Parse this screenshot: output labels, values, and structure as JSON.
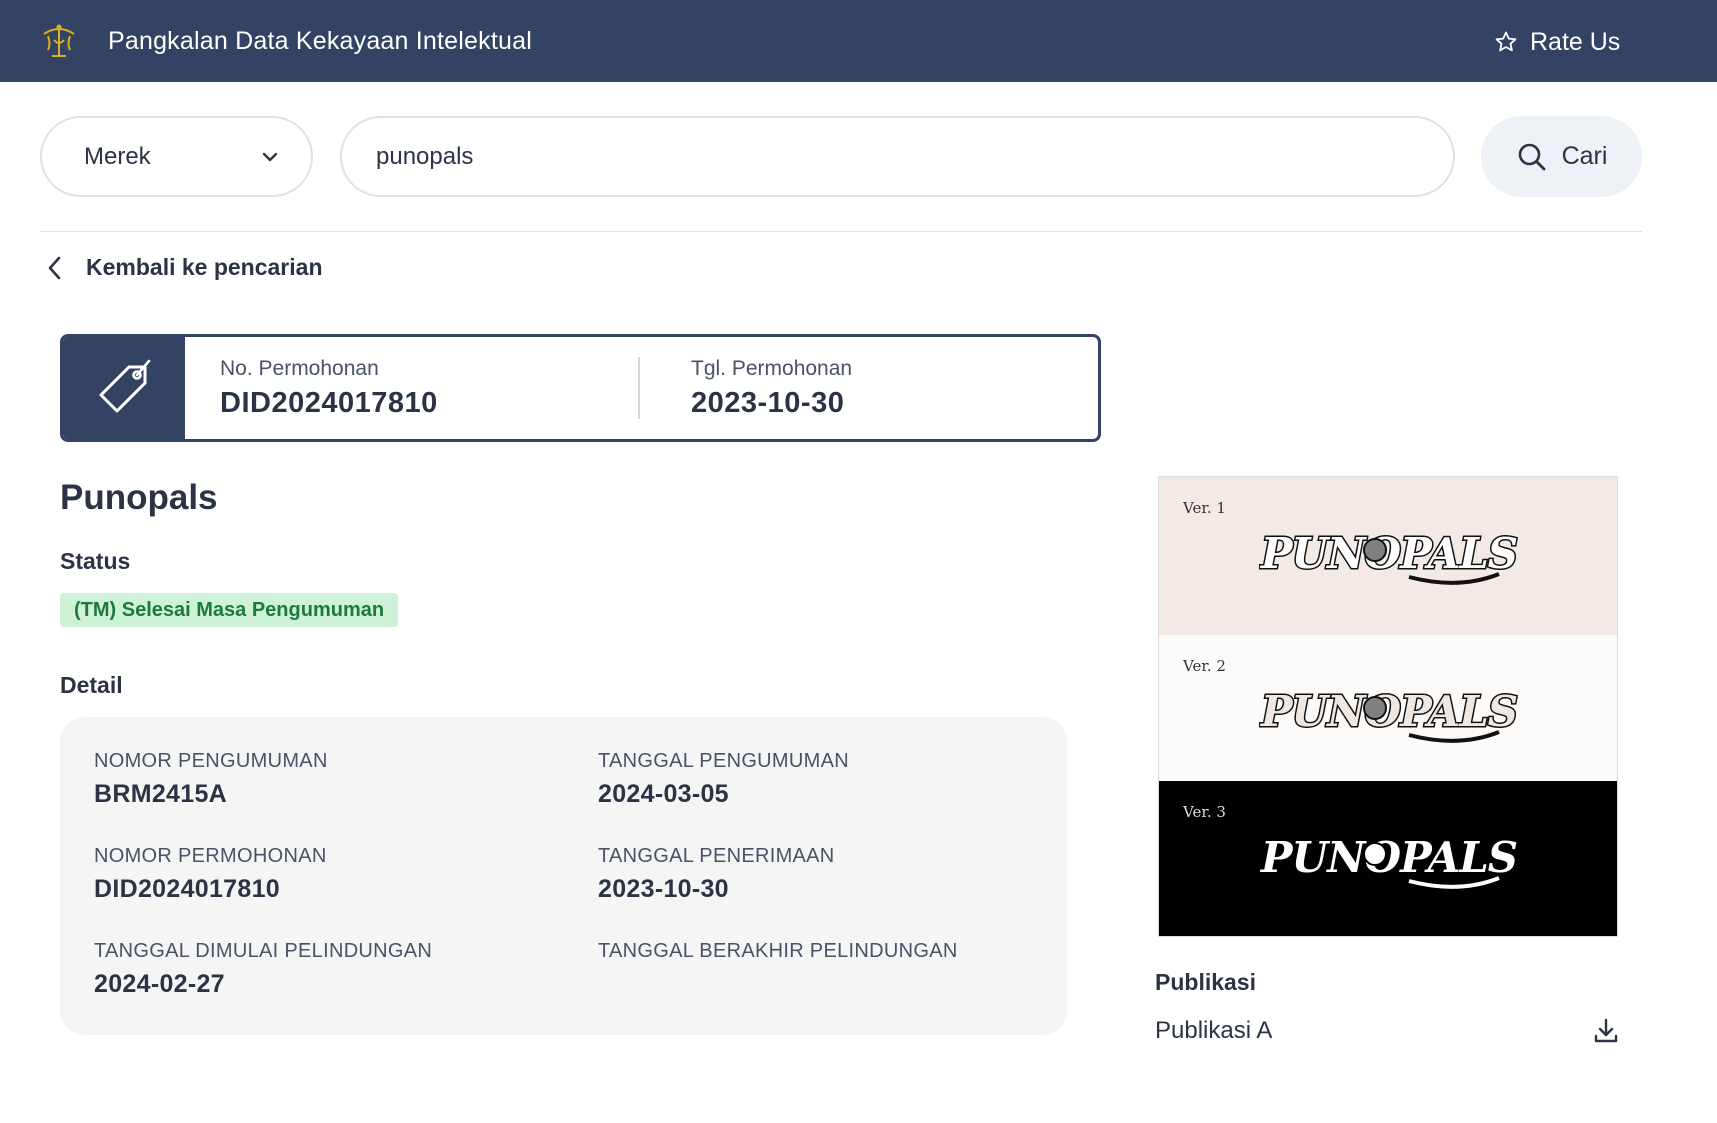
{
  "header": {
    "title": "Pangkalan Data Kekayaan Intelektual",
    "rate_us": "Rate Us",
    "logo_icon": "emblem-icon",
    "brand_color": "#344263",
    "accent_color": "#d9b321"
  },
  "search": {
    "category": "Merek",
    "query": "punopals",
    "button_label": "Cari"
  },
  "back_link": "Kembali ke pencarian",
  "application": {
    "no_label": "No. Permohonan",
    "no_value": "DID2024017810",
    "date_label": "Tgl. Permohonan",
    "date_value": "2023-10-30"
  },
  "mark": {
    "title": "Punopals",
    "status_label": "Status",
    "status_value": "(TM) Selesai Masa Pengumuman",
    "status_color": "#1e7a3c"
  },
  "detail": {
    "label": "Detail",
    "items": [
      {
        "label": "NOMOR PENGUMUMAN",
        "value": "BRM2415A"
      },
      {
        "label": "TANGGAL PENGUMUMAN",
        "value": "2024-03-05"
      },
      {
        "label": "NOMOR PERMOHONAN",
        "value": "DID2024017810"
      },
      {
        "label": "TANGGAL PENERIMAAN",
        "value": "2023-10-30"
      },
      {
        "label": "TANGGAL DIMULAI PELINDUNGAN",
        "value": "2024-02-27"
      },
      {
        "label": "TANGGAL BERAKHIR PELINDUNGAN",
        "value": ""
      }
    ]
  },
  "logo_versions": [
    {
      "label": "Ver. 1",
      "wordmark": "PUNOPALS",
      "background": "#f3e9e5"
    },
    {
      "label": "Ver. 2",
      "wordmark": "PUNOPALS",
      "background": "#fcfbfa"
    },
    {
      "label": "Ver. 3",
      "wordmark": "PUNOPALS",
      "background": "#000000"
    }
  ],
  "publikasi": {
    "label": "Publikasi",
    "items": [
      {
        "name": "Publikasi A",
        "icon": "download-icon"
      }
    ]
  }
}
